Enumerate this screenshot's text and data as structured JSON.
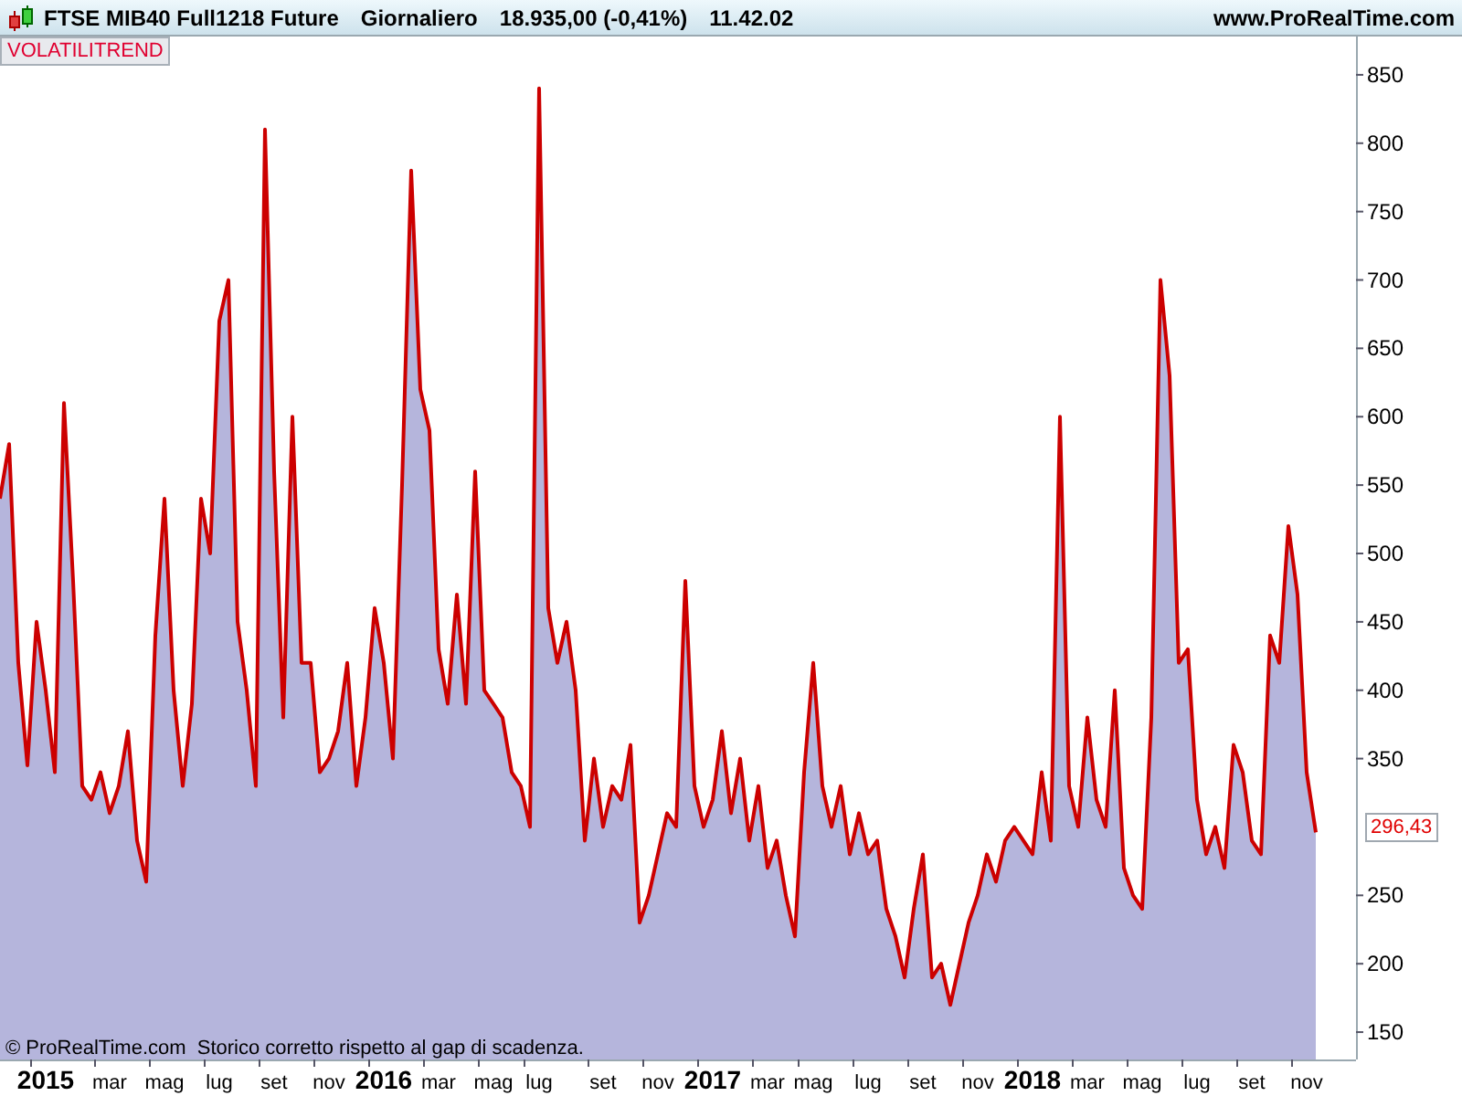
{
  "header": {
    "instrument": "FTSE MIB40 Full1218 Future",
    "period": "Giornaliero",
    "price": "18.935,00 (-0,41%)",
    "time": "11.42.02",
    "website": "www.ProRealTime.com"
  },
  "footer_note": "© ProRealTime.com  Storico corretto rispetto al gap di scadenza.",
  "last_value_label": "296,43",
  "chart_data": {
    "type": "area",
    "ylim": [
      130,
      878
    ],
    "categories": [
      null,
      null,
      null,
      null,
      null,
      "2015",
      null,
      null,
      null,
      null,
      null,
      null,
      "mar",
      null,
      null,
      null,
      null,
      null,
      "mag",
      null,
      null,
      null,
      null,
      null,
      "lug",
      null,
      null,
      null,
      null,
      null,
      "set",
      null,
      null,
      null,
      null,
      null,
      "nov",
      null,
      null,
      null,
      null,
      null,
      "2016",
      null,
      null,
      null,
      null,
      null,
      "mar",
      null,
      null,
      null,
      null,
      null,
      "mag",
      null,
      null,
      null,
      null,
      "lug",
      null,
      null,
      null,
      null,
      null,
      null,
      "set",
      null,
      null,
      null,
      null,
      null,
      "nov",
      null,
      null,
      null,
      null,
      null,
      "2017",
      null,
      null,
      null,
      null,
      null,
      "mar",
      null,
      null,
      null,
      null,
      "mag",
      null,
      null,
      null,
      null,
      null,
      "lug",
      null,
      null,
      null,
      null,
      null,
      "set",
      null,
      null,
      null,
      null,
      null,
      "nov",
      null,
      null,
      null,
      null,
      null,
      "2018",
      null,
      null,
      null,
      null,
      null,
      "mar",
      null,
      null,
      null,
      null,
      null,
      "mag",
      null,
      null,
      null,
      null,
      null,
      "lug",
      null,
      null,
      null,
      null,
      null,
      "set",
      null,
      null,
      null,
      null,
      null,
      "nov",
      null
    ],
    "yticks": [
      150,
      200,
      250,
      350,
      400,
      450,
      500,
      550,
      600,
      650,
      700,
      750,
      800,
      850
    ],
    "series": [
      {
        "name": "VOLATILITREND",
        "color": "#cc0000",
        "values": [
          540,
          580,
          420,
          345,
          450,
          400,
          340,
          610,
          480,
          330,
          320,
          340,
          310,
          330,
          370,
          290,
          260,
          440,
          540,
          400,
          330,
          390,
          540,
          500,
          670,
          700,
          450,
          400,
          330,
          810,
          560,
          380,
          600,
          420,
          420,
          340,
          350,
          370,
          420,
          330,
          380,
          460,
          420,
          350,
          550,
          780,
          620,
          590,
          430,
          390,
          470,
          390,
          560,
          400,
          390,
          380,
          340,
          330,
          300,
          840,
          460,
          420,
          450,
          400,
          290,
          350,
          300,
          330,
          320,
          360,
          230,
          250,
          280,
          310,
          300,
          480,
          330,
          300,
          320,
          370,
          310,
          350,
          290,
          330,
          270,
          290,
          250,
          220,
          340,
          420,
          330,
          300,
          330,
          280,
          310,
          280,
          290,
          240,
          220,
          190,
          240,
          280,
          190,
          200,
          170,
          200,
          230,
          250,
          280,
          260,
          290,
          300,
          290,
          280,
          340,
          290,
          600,
          330,
          300,
          380,
          320,
          300,
          400,
          270,
          250,
          240,
          380,
          700,
          630,
          420,
          430,
          320,
          280,
          300,
          270,
          360,
          340,
          290,
          280,
          440,
          420,
          520,
          470,
          340,
          296
        ]
      }
    ]
  }
}
